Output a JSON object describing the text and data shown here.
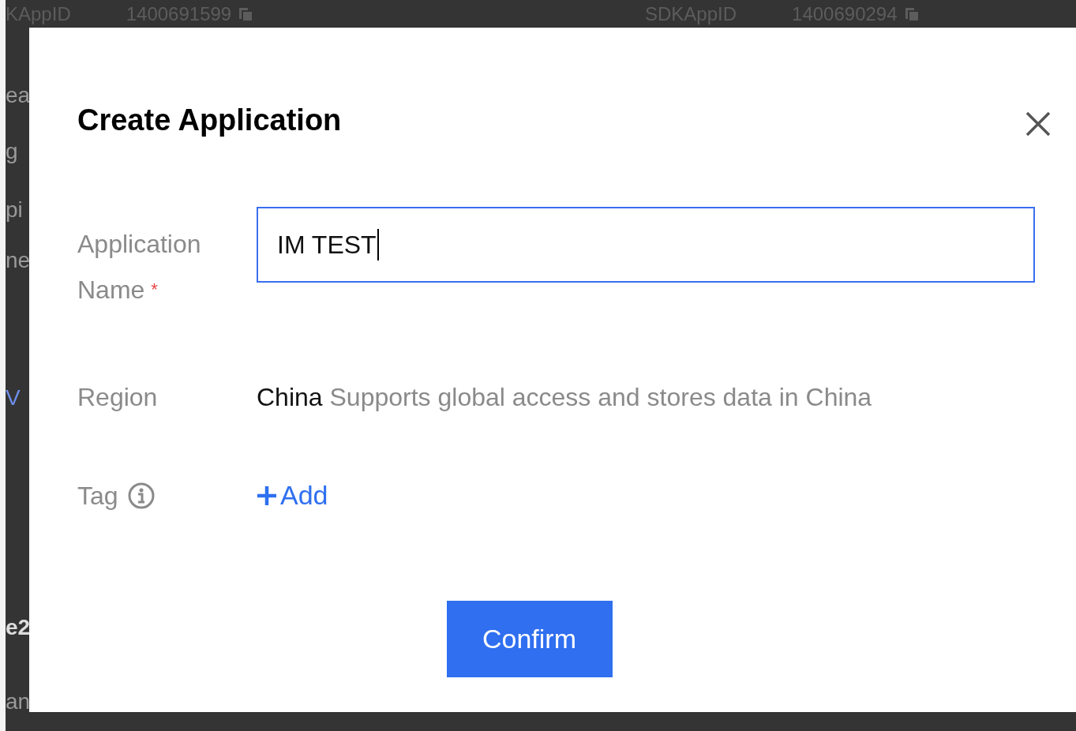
{
  "background": {
    "top_row": [
      {
        "label": "KAppID",
        "value": "1400691599"
      },
      {
        "label": "SDKAppID",
        "value": "1400690294"
      }
    ],
    "side_fragments": [
      {
        "text": "ea",
        "kind": "plain"
      },
      {
        "text": "g",
        "kind": "plain"
      },
      {
        "text": "pi",
        "kind": "plain"
      },
      {
        "text": "ne",
        "kind": "plain"
      },
      {
        "text": "V",
        "kind": "link"
      },
      {
        "text": "e2",
        "kind": "bold"
      },
      {
        "text": "an",
        "kind": "plain"
      }
    ]
  },
  "dialog": {
    "title": "Create Application",
    "fields": [
      {
        "kind": "input",
        "label": "Application Name",
        "required_mark": "*",
        "value": "IM TEST",
        "focused": true
      },
      {
        "kind": "text",
        "label": "Region",
        "value": "China",
        "note": "Supports global access and stores data in China"
      },
      {
        "kind": "tag",
        "label": "Tag",
        "action": "Add"
      }
    ],
    "confirm": "Confirm"
  }
}
